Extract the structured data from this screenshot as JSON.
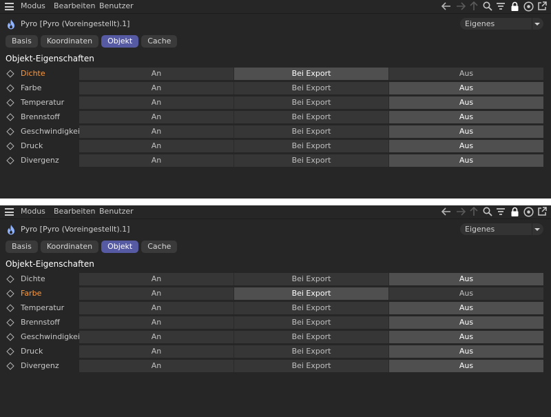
{
  "menu": {
    "modus": "Modus",
    "bearbeiten": "Bearbeiten",
    "benutzer": "Benutzer"
  },
  "object_title": "Pyro [Pyro (Voreingestellt).1]",
  "dropdown_value": "Eigenes",
  "tabs": [
    "Basis",
    "Koordinaten",
    "Objekt",
    "Cache"
  ],
  "active_tab": "Objekt",
  "section_title": "Objekt-Eigenschaften",
  "option_labels": [
    "An",
    "Bei Export",
    "Aus"
  ],
  "colors": {
    "highlight_label": "#ff9a3c",
    "active_tab": "#565aa3",
    "background": "#262626"
  },
  "panels": [
    {
      "highlighted_property": "Dichte",
      "properties": [
        {
          "label": "Dichte",
          "selected": "Bei Export"
        },
        {
          "label": "Farbe",
          "selected": "Aus"
        },
        {
          "label": "Temperatur",
          "selected": "Aus"
        },
        {
          "label": "Brennstoff",
          "selected": "Aus"
        },
        {
          "label": "Geschwindigkeit",
          "selected": "Aus"
        },
        {
          "label": "Druck",
          "selected": "Aus"
        },
        {
          "label": "Divergenz",
          "selected": "Aus"
        }
      ]
    },
    {
      "highlighted_property": "Farbe",
      "properties": [
        {
          "label": "Dichte",
          "selected": "Aus"
        },
        {
          "label": "Farbe",
          "selected": "Bei Export"
        },
        {
          "label": "Temperatur",
          "selected": "Aus"
        },
        {
          "label": "Brennstoff",
          "selected": "Aus"
        },
        {
          "label": "Geschwindigkeit",
          "selected": "Aus"
        },
        {
          "label": "Druck",
          "selected": "Aus"
        },
        {
          "label": "Divergenz",
          "selected": "Aus"
        }
      ]
    }
  ]
}
